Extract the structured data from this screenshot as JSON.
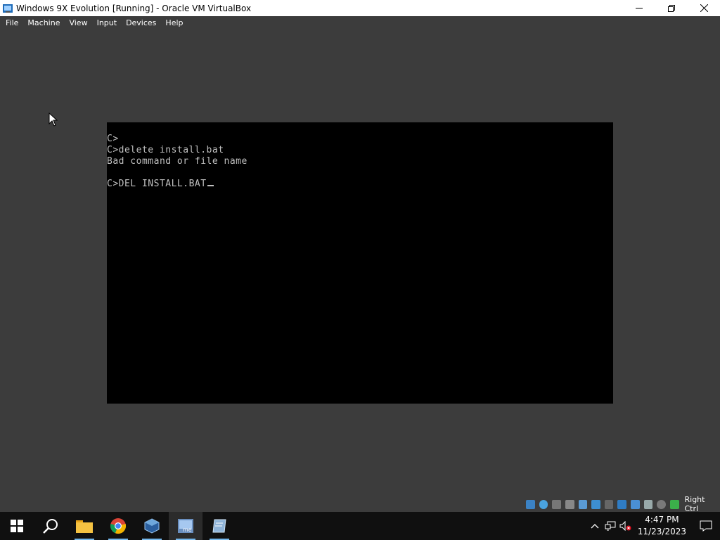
{
  "window": {
    "title": "Windows 9X Evolution [Running] - Oracle VM VirtualBox",
    "icons": [
      "virtualbox-icon",
      "minimize-icon",
      "maximize-icon",
      "close-icon"
    ]
  },
  "menubar": {
    "items": [
      "File",
      "Machine",
      "View",
      "Input",
      "Devices",
      "Help"
    ]
  },
  "vm_screen": {
    "lines": [
      "C>",
      "C>delete install.bat",
      "Bad command or file name",
      "",
      "C>DEL INSTALL.BAT"
    ],
    "background": "#000000",
    "text_color": "#c0c0c0"
  },
  "statusbar": {
    "icons": [
      "hard-disk-icon",
      "optical-drive-icon",
      "floppy-icon",
      "audio-icon",
      "network-icon",
      "usb-icon",
      "shared-folders-icon",
      "display-icon",
      "video-capture-icon",
      "virtualization-icon",
      "cpu-icon",
      "mouse-integration-icon"
    ],
    "host_key": "Right Ctrl"
  },
  "taskbar": {
    "apps": [
      "start-icon",
      "search-icon",
      "file-explorer-icon",
      "chrome-icon",
      "virtualbox-manager-icon",
      "windows-me-vm-icon",
      "notepad-icon"
    ],
    "tray_icons": [
      "show-hidden-icons-chevron",
      "network-icon",
      "volume-muted-icon"
    ],
    "time": "4:47 PM",
    "date": "11/23/2023",
    "accent": "#76b9ed"
  }
}
